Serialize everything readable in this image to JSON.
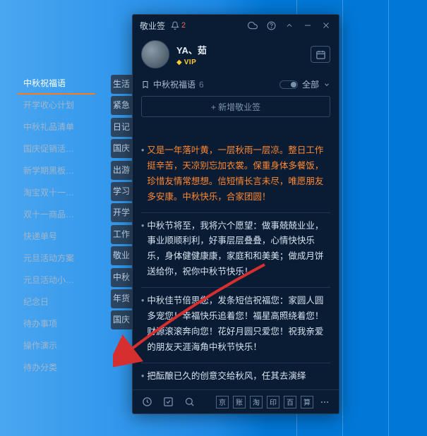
{
  "desktop": {
    "vlines": [
      420,
      485,
      550
    ]
  },
  "categories": [
    {
      "label": "中秋祝福语",
      "active": true
    },
    {
      "label": "开学收心计划"
    },
    {
      "label": "中秋礼品清单"
    },
    {
      "label": "国庆促销活…"
    },
    {
      "label": "新学期黑板…"
    },
    {
      "label": "淘宝双十一…"
    },
    {
      "label": "双十一商品…"
    },
    {
      "label": "快递单号"
    },
    {
      "label": "元旦活动方案"
    },
    {
      "label": "元旦活动小…"
    },
    {
      "label": "纪念日"
    },
    {
      "label": "待办事项"
    },
    {
      "label": "操作演示"
    },
    {
      "label": "待办分类"
    }
  ],
  "tags": [
    "生活",
    "紧急",
    "日记",
    "国庆",
    "出游",
    "学习",
    "开学",
    "工作",
    "敬业",
    "中秋",
    "年货",
    "国庆"
  ],
  "app": {
    "title": "敬业签",
    "notif_count": "2",
    "user": {
      "name": "YA、茹",
      "vip": "VIP"
    },
    "list": {
      "title": "中秋祝福语",
      "count": "6",
      "filter": "全部"
    },
    "addbar": "+ 新增敬业签",
    "notes": [
      {
        "color": "orange",
        "text": "又是一年落叶黄，一层秋雨一层凉。整日工作挺辛苦，天凉别忘加衣裳。保重身体多餐饭，珍惜友情常想想。信短情长言未尽，唯愿朋友多安康。中秋快乐，合家团圆！"
      },
      {
        "color": "white",
        "text": "中秋节将至，我将六个愿望：做事兢兢业业，事业顺顺利利，好事层层叠叠，心情快快乐乐，身体健健康康，家庭和和美美；做成月饼送给你，祝你中秋节快乐！"
      },
      {
        "color": "white",
        "text": "中秋佳节倍思您，发条短信祝福您：家圆人圆多宠您！幸福快乐追着您！福星高照绕着您！财源滚滚奔向您！花好月圆只爱您！祝我亲爱的朋友天涯海角中秋节快乐！"
      },
      {
        "color": "white",
        "text": "把酝酿已久的创意交给秋风，任其去演绎"
      }
    ],
    "bottom_squares": [
      "京",
      "账",
      "淘",
      "印",
      "百",
      "算"
    ]
  }
}
